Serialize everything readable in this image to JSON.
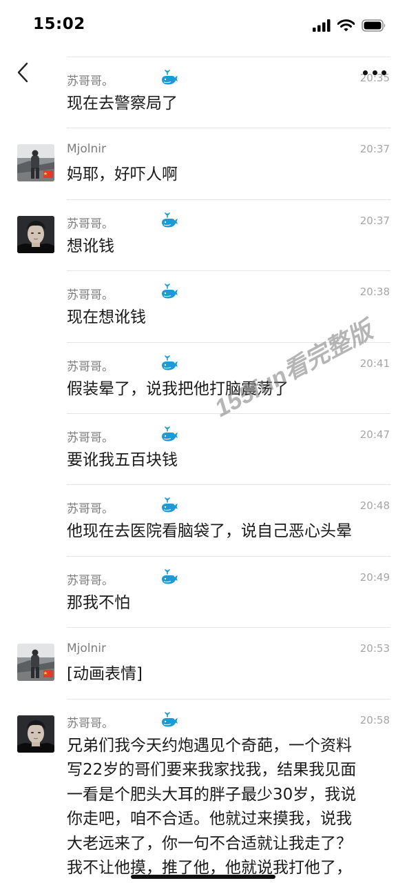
{
  "status": {
    "time": "15:02"
  },
  "icons": {
    "back": "chevron-left-icon",
    "more": "more-icon",
    "badge": "whale-icon",
    "flag": "china-flag-icon",
    "signal": "cellular-signal-icon",
    "wifi": "wifi-icon",
    "battery": "battery-icon"
  },
  "colors": {
    "badge": "#1a9ad6",
    "name": "#7d7d7d",
    "time": "#a6a6a6",
    "separator": "#e4e4e4"
  },
  "messages": [
    {
      "sender": "苏哥哥。",
      "time": "20:35",
      "text": "现在去警察局了",
      "badge": true,
      "avatar": ""
    },
    {
      "sender": "Mjolnir",
      "time": "20:37",
      "text": "妈耶，好吓人啊",
      "badge": false,
      "avatar": "mjolnir"
    },
    {
      "sender": "苏哥哥。",
      "time": "20:37",
      "text": "想讹钱",
      "badge": true,
      "avatar": "su"
    },
    {
      "sender": "苏哥哥。",
      "time": "20:38",
      "text": "现在想讹钱",
      "badge": true,
      "avatar": ""
    },
    {
      "sender": "苏哥哥。",
      "time": "20:41",
      "text": "假装晕了，说我把他打脑震荡了",
      "badge": true,
      "avatar": ""
    },
    {
      "sender": "苏哥哥。",
      "time": "20:47",
      "text": "要讹我五百块钱",
      "badge": true,
      "avatar": ""
    },
    {
      "sender": "苏哥哥。",
      "time": "20:48",
      "text": "他现在去医院看脑袋了，说自己恶心头晕",
      "badge": true,
      "avatar": ""
    },
    {
      "sender": "苏哥哥。",
      "time": "20:49",
      "text": "那我不怕",
      "badge": true,
      "avatar": ""
    },
    {
      "sender": "Mjolnir",
      "time": "20:53",
      "text": "[动画表情]",
      "badge": false,
      "avatar": "mjolnir"
    },
    {
      "sender": "苏哥哥。",
      "time": "20:58",
      "text_lines": [
        "兄弟们我今天约炮遇见个奇葩，一个资料",
        "写22岁的哥们要来我家找我，结果我见面",
        "一看是个肥头大耳的胖子最少30岁，我说",
        "你走吧，咱不合适。他就过来摸我，说我",
        "大老远来了，你一句不合适就让我走了？",
        "我不让他摸，推了他，他就说我打他了，"
      ],
      "badge": true,
      "avatar": "su"
    }
  ],
  "watermark": {
    "text": "155fun看完整版"
  }
}
